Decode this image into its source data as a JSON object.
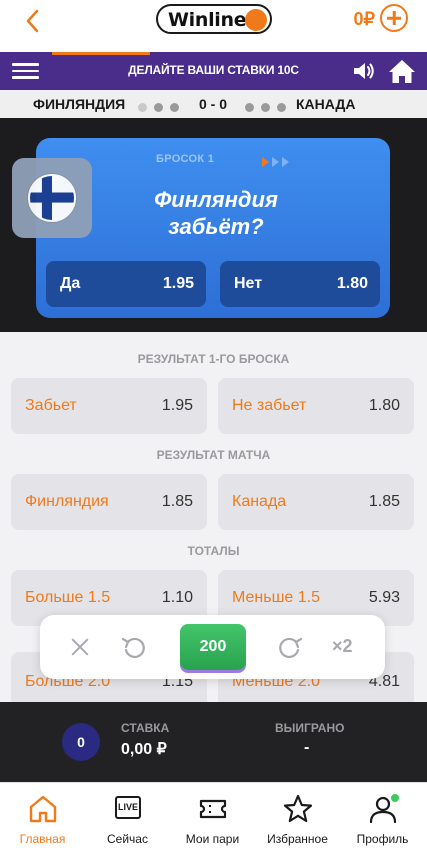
{
  "header": {
    "logo_text": "Winline",
    "balance": "0₽"
  },
  "promo": {
    "text": "ДЕЛАЙТЕ ВАШИ СТАВКИ 10С"
  },
  "match": {
    "team_left": "ФИНЛЯНДИЯ",
    "team_right": "КАНАДА",
    "score": "0 - 0"
  },
  "game": {
    "shot_label": "БРОСОК 1",
    "question": "Финляндия забьёт?",
    "yes_label": "Да",
    "yes_odd": "1.95",
    "no_label": "Нет",
    "no_odd": "1.80"
  },
  "markets": {
    "first_shot_title": "РЕЗУЛЬТАТ 1-ГО БРОСКА",
    "first_shot": [
      {
        "name": "Забьет",
        "odd": "1.95"
      },
      {
        "name": "Не забьет",
        "odd": "1.80"
      }
    ],
    "match_result_title": "РЕЗУЛЬТАТ МАТЧА",
    "match_result": [
      {
        "name": "Финляндия",
        "odd": "1.85"
      },
      {
        "name": "Канада",
        "odd": "1.85"
      }
    ],
    "totals_title": "ТОТАЛЫ",
    "totals": [
      {
        "name": "Больше 1.5",
        "odd": "1.10"
      },
      {
        "name": "Меньше 1.5",
        "odd": "5.93"
      },
      {
        "name": "Больше 2.0",
        "odd": "1.15"
      },
      {
        "name": "Меньше 2.0",
        "odd": "4.81"
      }
    ]
  },
  "stake_control": {
    "chip_value": "200",
    "multiplier": "×2"
  },
  "stake_info": {
    "count": "0",
    "stake_label": "СТАВКА",
    "stake_value": "0,00 ₽",
    "won_label": "ВЫИГРАНО",
    "won_value": "-"
  },
  "tabs": [
    {
      "label": "Главная",
      "icon": "home-icon"
    },
    {
      "label": "Сейчас",
      "icon": "live-icon",
      "badge": "LIVE"
    },
    {
      "label": "Мои пари",
      "icon": "ticket-icon"
    },
    {
      "label": "Избранное",
      "icon": "star-icon"
    },
    {
      "label": "Профиль",
      "icon": "profile-icon"
    }
  ],
  "colors": {
    "accent": "#f07a1a",
    "purple": "#4a2c8a",
    "card_blue": "#3f8ef0",
    "chip_green": "#29a24f"
  }
}
